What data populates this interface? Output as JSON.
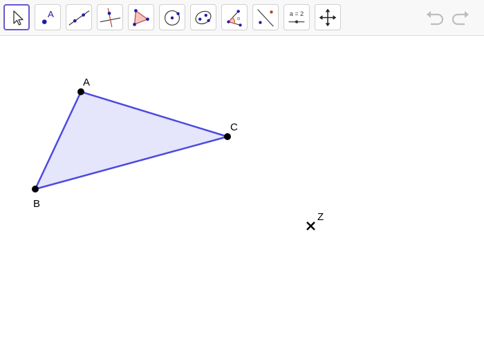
{
  "toolbar": {
    "tools": [
      {
        "name": "move",
        "icon": "cursor-arrow-icon",
        "selected": true
      },
      {
        "name": "point",
        "icon": "point-icon",
        "label": "A"
      },
      {
        "name": "line",
        "icon": "line-through-two-points-icon"
      },
      {
        "name": "perpendicular-line",
        "icon": "perpendicular-line-icon"
      },
      {
        "name": "polygon",
        "icon": "polygon-icon"
      },
      {
        "name": "circle-center-point",
        "icon": "circle-icon"
      },
      {
        "name": "ellipse",
        "icon": "ellipse-icon"
      },
      {
        "name": "angle",
        "icon": "angle-icon",
        "label": "α"
      },
      {
        "name": "reflect",
        "icon": "reflect-about-line-icon"
      },
      {
        "name": "slider",
        "icon": "slider-icon",
        "label": "a = 2"
      },
      {
        "name": "move-graphics-view",
        "icon": "move-graphics-view-icon"
      }
    ],
    "undo_icon": "undo-icon",
    "redo_icon": "redo-icon"
  },
  "colors": {
    "selected_border": "#6557d2",
    "polygon_stroke": "#4c49e0",
    "polygon_fill": "#e5e5fb",
    "point_fill": "#000000",
    "icon_blue": "#1e1ea8",
    "icon_red": "#c0392b",
    "disabled": "#bdbdbd"
  },
  "graphics": {
    "points": [
      {
        "label": "A"
      },
      {
        "label": "B"
      },
      {
        "label": "C"
      },
      {
        "label": "Z"
      }
    ]
  }
}
